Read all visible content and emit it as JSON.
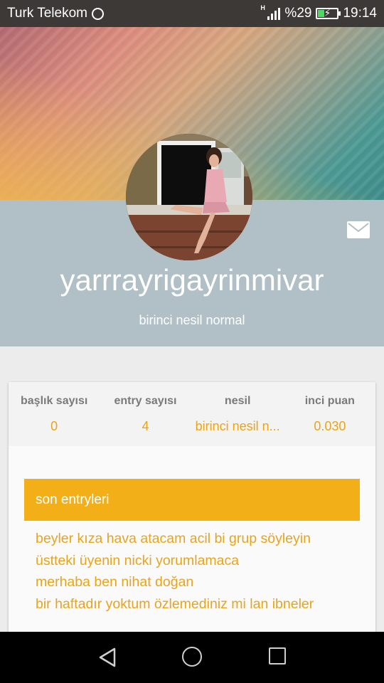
{
  "status_bar": {
    "carrier": "Turk Telekom",
    "network_type": "H",
    "battery_percent": "%29",
    "time": "19:14",
    "icons": [
      "whatsapp-icon",
      "signal-icon",
      "battery-charging-icon"
    ]
  },
  "profile": {
    "username": "yarrrayrigayrinmivar",
    "generation": "birinci nesil normal",
    "avatar_icon": "profile-photo",
    "message_icon": "mail-icon"
  },
  "stats": [
    {
      "label": "başlık sayısı",
      "value": "0"
    },
    {
      "label": "entry sayısı",
      "value": "4"
    },
    {
      "label": "nesil",
      "value": "birinci nesil n..."
    },
    {
      "label": "inci puan",
      "value": "0.030"
    }
  ],
  "recent_entries": {
    "title": "son entryleri",
    "items": [
      "beyler kıza hava atacam acil bi grup söyleyin",
      "üstteki üyenin nicki yorumlamaca",
      "merhaba ben nihat doğan",
      "bir haftadır yoktum özlemediniz mi lan ibneler"
    ]
  },
  "nav_bar": {
    "icons": [
      "back-icon",
      "home-icon",
      "recents-icon"
    ]
  },
  "colors": {
    "accent": "#f2af17",
    "accent_text": "#e8a41b",
    "profile_panel": "#b1c0c6",
    "status_bar": "#3d3936"
  }
}
